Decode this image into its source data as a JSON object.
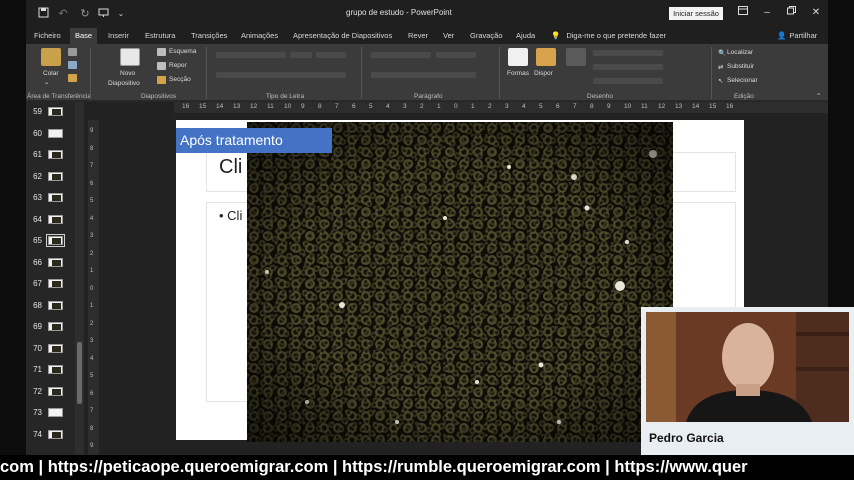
{
  "window": {
    "doc_title": "grupo de estudo  -  PowerPoint",
    "signin_label": "Iniciar sessão"
  },
  "tabs": [
    {
      "label": "Ficheiro"
    },
    {
      "label": "Base"
    },
    {
      "label": "Inserir"
    },
    {
      "label": "Estrutura"
    },
    {
      "label": "Transições"
    },
    {
      "label": "Animações"
    },
    {
      "label": "Apresentação de Diapositivos"
    },
    {
      "label": "Rever"
    },
    {
      "label": "Ver"
    },
    {
      "label": "Gravação"
    },
    {
      "label": "Ajuda"
    }
  ],
  "tell_me": "Diga-me o que pretende fazer",
  "share_label": "Partilhar",
  "ribbon": {
    "paste_label": "Colar",
    "new_slide_label": "Novo",
    "new_slide_label2": "Diapositivo",
    "layout_label": "Esquema",
    "reset_label": "Repor",
    "section_label": "Secção",
    "shapes_label": "Formas",
    "arrange_label": "Dispor",
    "find_label": "Localizar",
    "replace_label": "Substituir",
    "select_label": "Selecionar",
    "groups": {
      "clipboard": "Área de Transferência",
      "slides": "Diapositivos",
      "font": "Tipo de Letra",
      "paragraph": "Parágrafo",
      "drawing": "Desenho",
      "editing": "Edição"
    }
  },
  "thumbnails": [
    {
      "num": "59"
    },
    {
      "num": "60"
    },
    {
      "num": "61"
    },
    {
      "num": "62"
    },
    {
      "num": "63"
    },
    {
      "num": "64"
    },
    {
      "num": "65"
    },
    {
      "num": "66"
    },
    {
      "num": "67"
    },
    {
      "num": "68"
    },
    {
      "num": "69"
    },
    {
      "num": "70"
    },
    {
      "num": "71"
    },
    {
      "num": "72"
    },
    {
      "num": "73"
    },
    {
      "num": "74"
    }
  ],
  "selected_thumbnail": "65",
  "ruler_h": [
    "16",
    "15",
    "14",
    "13",
    "12",
    "11",
    "10",
    "9",
    "8",
    "7",
    "6",
    "5",
    "4",
    "3",
    "2",
    "1",
    "0",
    "1",
    "2",
    "3",
    "4",
    "5",
    "6",
    "7",
    "8",
    "9",
    "10",
    "11",
    "12",
    "13",
    "14",
    "15",
    "16"
  ],
  "ruler_v": [
    "9",
    "8",
    "7",
    "6",
    "5",
    "4",
    "3",
    "2",
    "1",
    "0",
    "1",
    "2",
    "3",
    "4",
    "5",
    "6",
    "7",
    "8",
    "9"
  ],
  "slide": {
    "banner_title": "Após tratamento",
    "title_placeholder": "Cli",
    "body_placeholder": "• Cli"
  },
  "webcam": {
    "name": "Pedro Garcia"
  },
  "ticker": "com | https://peticaope.queroemigrar.com | https://rumble.queroemigrar.com | https://www.quer",
  "colors": {
    "accent_banner": "#4472c4",
    "app_background": "#262626",
    "ribbon": "#3b3b3b"
  }
}
